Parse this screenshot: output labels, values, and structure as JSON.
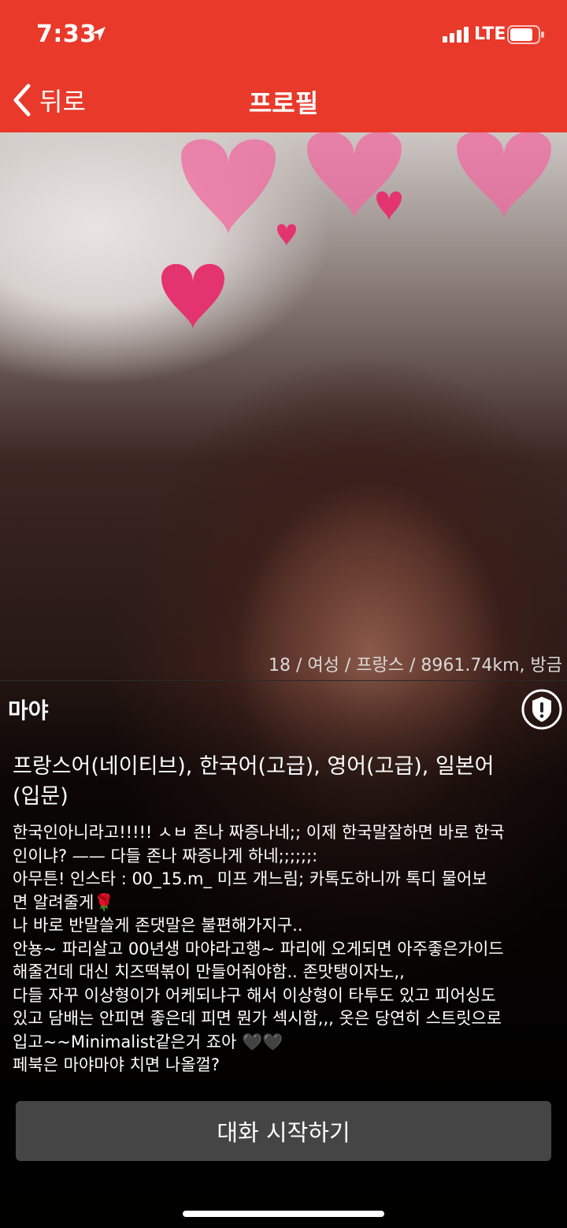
{
  "status_bar": {
    "time": "7:33",
    "network": "LTE",
    "icons": [
      "location-arrow-icon",
      "signal-bars-icon",
      "battery-icon"
    ]
  },
  "nav": {
    "back_label": "뒤로",
    "title": "프로필",
    "back_icon": "chevron-left-icon"
  },
  "profile": {
    "meta": "18 / 여성 / 프랑스 / 8961.74km, 방금",
    "name": "마야",
    "report_icon": "shield-alert-icon",
    "languages": "프랑스어(네이티브), 한국어(고급), 영어(고급), 일본어\n(입문)",
    "bio": "한국인아니라고!!!!! ㅅㅂ 존나 짜증나네;; 이제 한국말잘하면 바로 한국\n인이냐? —— 다들 존나 짜증나게 하네;;;;;;:\n아무튼! 인스타 : 00_15.m_ 미프 개느림; 카톡도하니까 톡디 물어보\n면 알려줄게🌹\n나 바로 반말쓸게 존댓말은 불편해가지구..\n안뇽~ 파리살고 00년생 마야라고행~ 파리에 오게되면 아주좋은가이드\n해줄건데 대신 치즈떡볶이 만들어줘야함.. 존맛탱이자노,,\n다들 자꾸 이상형이가 어케되냐구 해서 이상형이 타투도 있고 피어싱도\n있고 담배는 안피면 좋은데 피면 뭔가 섹시함,,, 옷은 당연히 스트릿으로\n입고~~Minimalist같은거 죠아 🖤🖤\n페북은 마야마야 치면 나올껄?"
  },
  "actions": {
    "start_chat_label": "대화 시작하기"
  },
  "colors": {
    "header_bg": "#e8392a",
    "button_bg": "#454545",
    "text": "#ffffff"
  }
}
